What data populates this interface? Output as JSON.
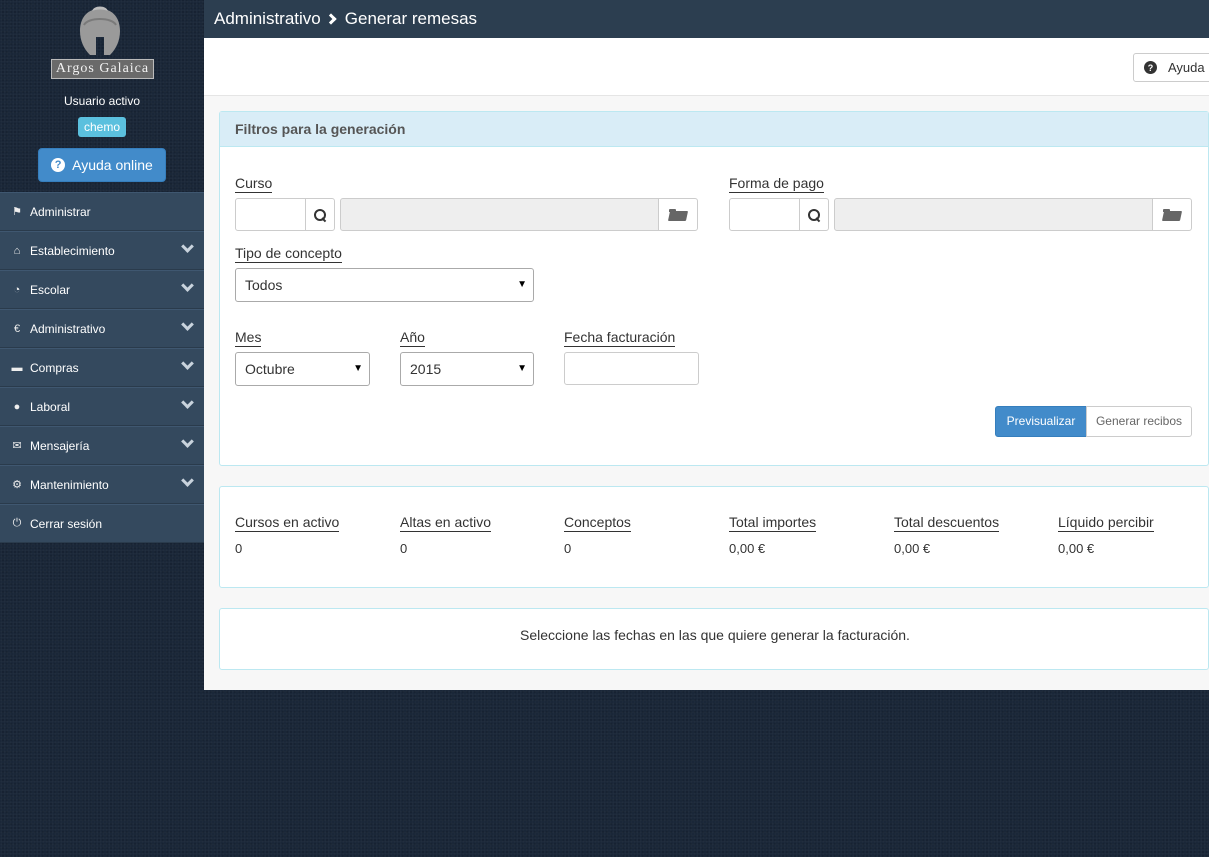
{
  "sidebar": {
    "logo_text": "Argos Galaica",
    "user_label": "Usuario activo",
    "user_name": "chemo",
    "help_online": "Ayuda online",
    "items": [
      {
        "label": "Administrar",
        "icon": "flag-icon"
      },
      {
        "label": "Establecimiento",
        "icon": "home-icon"
      },
      {
        "label": "Escolar",
        "icon": "dashboard-icon"
      },
      {
        "label": "Administrativo",
        "icon": "euro-icon"
      },
      {
        "label": "Compras",
        "icon": "briefcase-icon"
      },
      {
        "label": "Laboral",
        "icon": "user-icon"
      },
      {
        "label": "Mensajería",
        "icon": "envelope-icon"
      },
      {
        "label": "Mantenimiento",
        "icon": "cog-icon"
      },
      {
        "label": "Cerrar sesión",
        "icon": "power-icon"
      }
    ]
  },
  "header": {
    "section": "Administrativo",
    "page": "Generar remesas"
  },
  "toolbar": {
    "help": "Ayuda"
  },
  "filters": {
    "title": "Filtros para la generación",
    "curso_label": "Curso",
    "curso_value": "",
    "forma_pago_label": "Forma de pago",
    "forma_pago_value": "",
    "tipo_concepto_label": "Tipo de concepto",
    "tipo_concepto_value": "Todos",
    "mes_label": "Mes",
    "mes_value": "Octubre",
    "anio_label": "Año",
    "anio_value": "2015",
    "fecha_label": "Fecha facturación",
    "fecha_value": "",
    "preview_button": "Previsualizar",
    "generate_button": "Generar recibos"
  },
  "summary": [
    {
      "label": "Cursos en activo",
      "value": "0"
    },
    {
      "label": "Altas en activo",
      "value": "0"
    },
    {
      "label": "Conceptos",
      "value": "0"
    },
    {
      "label": "Total importes",
      "value": "0,00 €"
    },
    {
      "label": "Total descuentos",
      "value": "0,00 €"
    },
    {
      "label": "Líquido percibir",
      "value": "0,00 €"
    }
  ],
  "message": "Seleccione las fechas en las que quiere generar la facturación.",
  "colors": {
    "sidebar_item": "#34495e",
    "topbar": "#2c3e50",
    "primary": "#428bca",
    "info_badge": "#5bc0de",
    "panel_heading": "#d9edf7"
  }
}
